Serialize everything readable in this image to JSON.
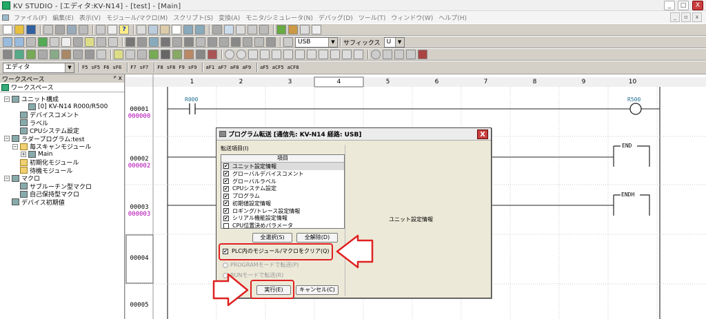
{
  "window": {
    "title": "KV STUDIO - [エディタ:KV-N14] - [test] - [Main]",
    "min_label": "_",
    "max_label": "□",
    "close_label": "X"
  },
  "menu": [
    "ファイル(F)",
    "編集(E)",
    "表示(V)",
    "モジュール/マクロ(M)",
    "スクリプト(S)",
    "変換(A)",
    "モニタ/シミュレータ(N)",
    "デバッグ(D)",
    "ツール(T)",
    "ウィンドウ(W)",
    "ヘルプ(H)"
  ],
  "toolbar": {
    "port_value": "USB",
    "suffix_label": "サフィックス",
    "suffix_value": "U",
    "mode_value": "エディタ",
    "func_keys": [
      "F5",
      "sF5",
      "F6",
      "sF6",
      "F7",
      "sF7",
      "F8",
      "sF8",
      "F9",
      "sF9",
      "aF1",
      "aF7",
      "aF8",
      "aF9",
      "aF5",
      "aCF5",
      "aCF8"
    ],
    "func_glyphs": [
      "-|/|-",
      "-|\\|-",
      "-|/|-",
      "-|\\|-",
      "-| |-",
      "-|/|-",
      "-( )-",
      "-(/)-",
      "-| |-",
      "-(/)-",
      "-|↑|-",
      "-|↓|-",
      "-|↑|-",
      "-|↓|-",
      "-|↑|-",
      "-|↓|-",
      "-|↑|-"
    ]
  },
  "workspace": {
    "header": "ワークスペース",
    "pin": "ᵖ x",
    "tab": "ワークスペース",
    "tree": [
      {
        "label": "ユニット構成",
        "depth": 0,
        "exp": "−"
      },
      {
        "label": "[0]  KV-N14        R000/R500",
        "depth": 2,
        "exp": ""
      },
      {
        "label": "デバイスコメント",
        "depth": 1,
        "exp": ""
      },
      {
        "label": "ラベル",
        "depth": 1,
        "exp": ""
      },
      {
        "label": "CPUシステム設定",
        "depth": 1,
        "exp": ""
      },
      {
        "label": "ラダープログラム:test",
        "depth": 0,
        "exp": "−"
      },
      {
        "label": "毎スキャンモジュール",
        "depth": 1,
        "exp": "−",
        "folder": true
      },
      {
        "label": "Main",
        "depth": 2,
        "exp": "+"
      },
      {
        "label": "初期化モジュール",
        "depth": 1,
        "exp": "",
        "folder": true
      },
      {
        "label": "待機モジュール",
        "depth": 1,
        "exp": "",
        "folder": true
      },
      {
        "label": "マクロ",
        "depth": 0,
        "exp": "−"
      },
      {
        "label": "サブルーチン型マクロ",
        "depth": 1,
        "exp": ""
      },
      {
        "label": "自己保持型マクロ",
        "depth": 1,
        "exp": ""
      },
      {
        "label": "デバイス初期値",
        "depth": 0,
        "exp": ""
      }
    ]
  },
  "ladder": {
    "columns": [
      "1",
      "2",
      "3",
      "4",
      "5",
      "6",
      "7",
      "8",
      "9",
      "10"
    ],
    "rungs": [
      {
        "num": "00001",
        "sub": "000000"
      },
      {
        "num": "00002",
        "sub": "000002"
      },
      {
        "num": "00003",
        "sub": "000003"
      },
      {
        "num": "00004",
        "sub": ""
      },
      {
        "num": "00005",
        "sub": ""
      }
    ],
    "contact": "R000",
    "coil": "R500",
    "end_label": "END",
    "endh_label": "ENDH"
  },
  "dialog": {
    "title": "プログラム転送 [通信先: KV-N14  経路: USB]",
    "close": "X",
    "section_label": "転送項目(I)",
    "list_header": "項目",
    "items": [
      {
        "label": "ユニット設定情報",
        "checked": true
      },
      {
        "label": "グローバルデバイスコメント",
        "checked": true
      },
      {
        "label": "グローバルラベル",
        "checked": true
      },
      {
        "label": "CPUシステム設定",
        "checked": true
      },
      {
        "label": "プログラム",
        "checked": true
      },
      {
        "label": "初期値設定情報",
        "checked": true
      },
      {
        "label": "ロギング/トレース設定情報",
        "checked": true
      },
      {
        "label": "シリアル機能設定情報",
        "checked": true
      },
      {
        "label": "CPU位置決めパラメータ",
        "checked": false
      }
    ],
    "select_all": "全選択(S)",
    "deselect_all": "全解除(D)",
    "clear_option": "PLC内のモジュール/マクロをクリア(Q)",
    "radio_program": "PROGRAMモードで転送(P)",
    "radio_run": "RUNモードで転送(R)",
    "execute": "実行(E)",
    "cancel": "キャンセル(C)",
    "detail_text": "ユニット設定情報"
  },
  "annotation_color": "#e02020"
}
